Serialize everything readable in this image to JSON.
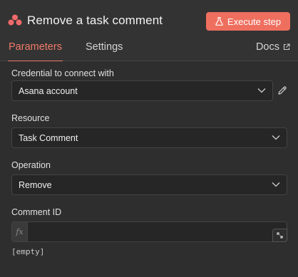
{
  "header": {
    "title": "Remove a task comment",
    "execute_label": "Execute step",
    "logo_icon": "asana-logo-icon",
    "accent_color": "#ef6f5f"
  },
  "tabs": [
    {
      "label": "Parameters",
      "active": true
    },
    {
      "label": "Settings",
      "active": false
    },
    {
      "label": "Docs",
      "active": false,
      "icon": "external-link-icon"
    }
  ],
  "fields": {
    "credential": {
      "label": "Credential to connect with",
      "value": "Asana account"
    },
    "resource": {
      "label": "Resource",
      "value": "Task Comment"
    },
    "operation": {
      "label": "Operation",
      "value": "Remove"
    },
    "comment_id": {
      "label": "Comment ID",
      "value": "",
      "fx": "fx",
      "hint": "[empty]"
    }
  }
}
